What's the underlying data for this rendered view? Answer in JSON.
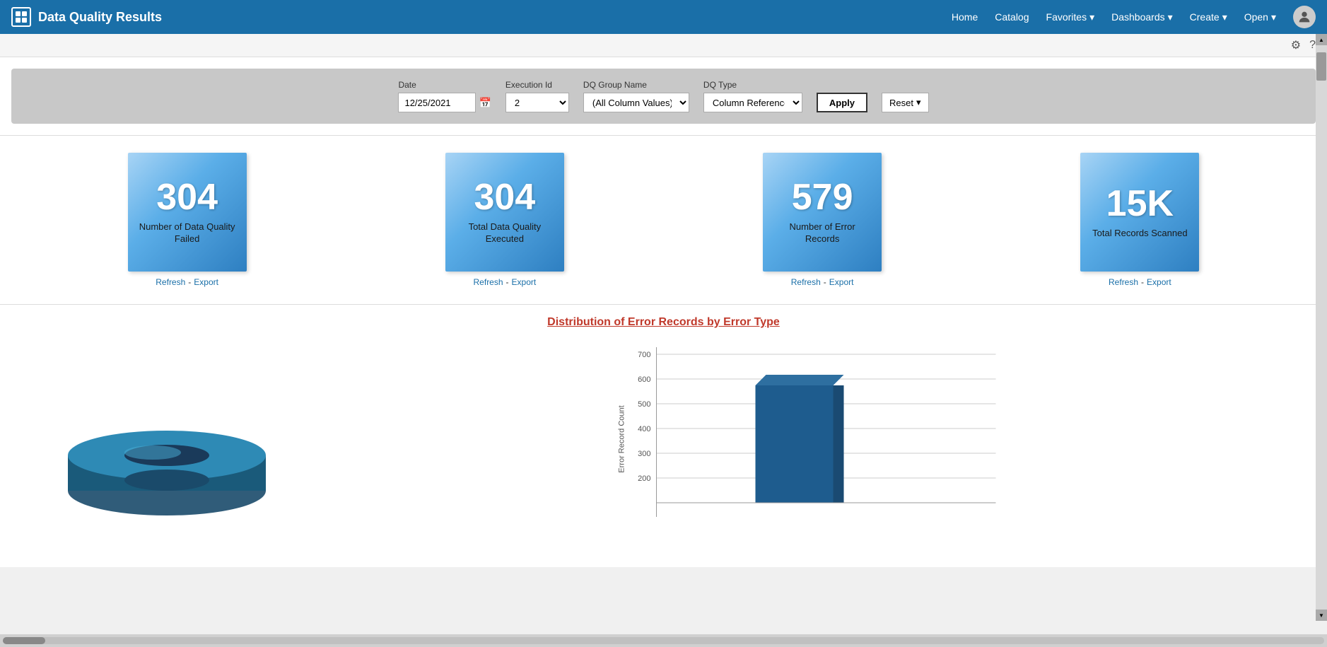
{
  "app": {
    "title": "Data Quality Results",
    "logo_icon": "▣"
  },
  "topnav": {
    "links": [
      {
        "label": "Home",
        "dropdown": false
      },
      {
        "label": "Catalog",
        "dropdown": false
      },
      {
        "label": "Favorites",
        "dropdown": true
      },
      {
        "label": "Dashboards",
        "dropdown": true
      },
      {
        "label": "Create",
        "dropdown": true
      },
      {
        "label": "Open",
        "dropdown": true
      }
    ]
  },
  "filters": {
    "date_label": "Date",
    "date_value": "12/25/2021",
    "execution_id_label": "Execution Id",
    "execution_id_value": "2",
    "dq_group_label": "DQ Group Name",
    "dq_group_value": "(All Column Values)",
    "dq_type_label": "DQ Type",
    "dq_type_value": "Column Reference",
    "apply_label": "Apply",
    "reset_label": "Reset"
  },
  "kpi_cards": [
    {
      "number": "304",
      "label": "Number of Data Quality Failed",
      "refresh_label": "Refresh",
      "export_label": "Export"
    },
    {
      "number": "304",
      "label": "Total Data Quality Executed",
      "refresh_label": "Refresh",
      "export_label": "Export"
    },
    {
      "number": "579",
      "label": "Number of Error Records",
      "refresh_label": "Refresh",
      "export_label": "Export"
    },
    {
      "number": "15K",
      "label": "Total Records Scanned",
      "refresh_label": "Refresh",
      "export_label": "Export"
    }
  ],
  "chart": {
    "title": "Distribution of Error Records by Error Type",
    "bar": {
      "y_axis_label": "Error Record Count",
      "y_axis_values": [
        "700",
        "600",
        "500",
        "400",
        "300",
        "200"
      ],
      "bar_height_pct": 85,
      "bar_value": 579
    }
  }
}
